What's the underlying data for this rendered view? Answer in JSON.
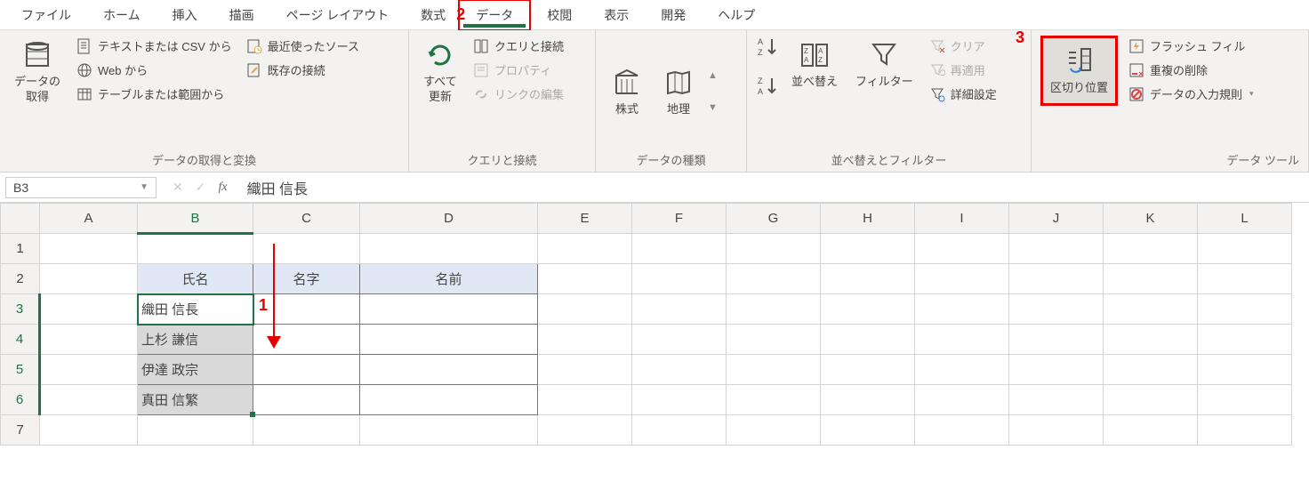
{
  "menu": {
    "file": "ファイル",
    "home": "ホーム",
    "insert": "挿入",
    "draw": "描画",
    "pagelayout": "ページ レイアウト",
    "formulas": "数式",
    "data": "データ",
    "review": "校閲",
    "view": "表示",
    "developer": "開発",
    "help": "ヘルプ"
  },
  "annotations": {
    "a1": "1",
    "a2": "2",
    "a3": "3"
  },
  "ribbon": {
    "get_transform": {
      "get_data": "データの\n取得",
      "from_text_csv": "テキストまたは CSV から",
      "from_web": "Web から",
      "from_table_range": "テーブルまたは範囲から",
      "recent_sources": "最近使ったソース",
      "existing_connections": "既存の接続",
      "group_label": "データの取得と変換"
    },
    "queries": {
      "refresh_all": "すべて\n更新",
      "queries_connections": "クエリと接続",
      "properties": "プロパティ",
      "edit_links": "リンクの編集",
      "group_label": "クエリと接続"
    },
    "data_types": {
      "stocks": "株式",
      "geography": "地理",
      "group_label": "データの種類"
    },
    "sort_filter": {
      "sort_asc_name": "sort-asc-button",
      "sort_desc_name": "sort-desc-button",
      "sort": "並べ替え",
      "filter": "フィルター",
      "clear": "クリア",
      "reapply": "再適用",
      "advanced": "詳細設定",
      "group_label": "並べ替えとフィルター"
    },
    "data_tools": {
      "text_to_columns": "区切り位置",
      "flash_fill": "フラッシュ フィル",
      "remove_duplicates": "重複の削除",
      "data_validation": "データの入力規則",
      "group_label": "データ ツール"
    }
  },
  "formula_bar": {
    "name_box": "B3",
    "fx_label": "fx",
    "formula": "織田 信長"
  },
  "grid": {
    "columns": [
      "A",
      "B",
      "C",
      "D",
      "E",
      "F",
      "G",
      "H",
      "I",
      "J",
      "K",
      "L"
    ],
    "rows": [
      "1",
      "2",
      "3",
      "4",
      "5",
      "6",
      "7"
    ],
    "headers": {
      "b2": "氏名",
      "c2": "名字",
      "d2": "名前"
    },
    "data": {
      "b3": "織田 信長",
      "b4": "上杉 謙信",
      "b5": "伊達 政宗",
      "b6": "真田 信繁"
    }
  }
}
